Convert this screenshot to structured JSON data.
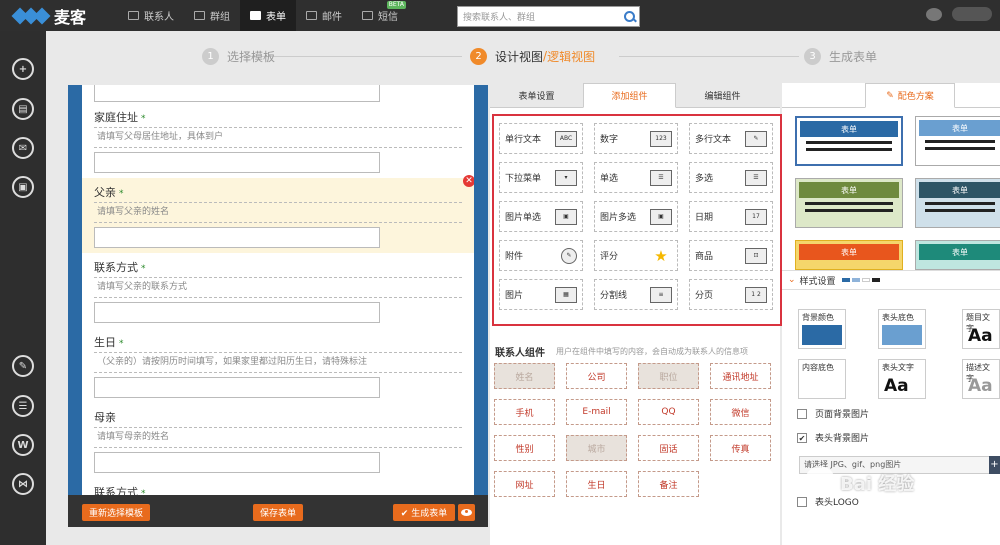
{
  "app": {
    "name": "麦客"
  },
  "nav": [
    {
      "label": "联系人"
    },
    {
      "label": "群组"
    },
    {
      "label": "表单"
    },
    {
      "label": "邮件"
    },
    {
      "label": "短信",
      "badge": "BETA"
    }
  ],
  "search": {
    "placeholder": "搜索联系人、群组"
  },
  "steps": [
    {
      "num": "1",
      "label": "选择模板"
    },
    {
      "num": "2",
      "label_a": "设计视图",
      "sep": "/",
      "label_b": "逻辑视图"
    },
    {
      "num": "3",
      "label": "生成表单"
    }
  ],
  "form": {
    "fields": [
      {
        "title": "家庭住址",
        "hint": "请填写父母居住地址，具体到户"
      },
      {
        "title": "父亲",
        "hint": "请填写父亲的姓名"
      },
      {
        "title": "联系方式",
        "hint": "请填写父亲的联系方式"
      },
      {
        "title": "生日",
        "hint": "（父亲的）请按阴历时间填写，如果家里都过阳历生日，请特殊标注"
      },
      {
        "title": "母亲",
        "hint": "请填写母亲的姓名"
      },
      {
        "title": "联系方式"
      }
    ],
    "required_mark": "*",
    "delete_symbol": "✕",
    "buttons": {
      "reselect": "重新选择模板",
      "save": "保存表单",
      "generate": "✔ 生成表单"
    }
  },
  "mid_tabs": [
    "表单设置",
    "添加组件",
    "编辑组件"
  ],
  "components": [
    {
      "label": "单行文本",
      "icon": "ABC"
    },
    {
      "label": "数字",
      "icon": "123"
    },
    {
      "label": "多行文本",
      "icon": "✎"
    },
    {
      "label": "下拉菜单",
      "icon": "▾"
    },
    {
      "label": "单选",
      "icon": "☰"
    },
    {
      "label": "多选",
      "icon": "☰"
    },
    {
      "label": "图片单选",
      "icon": "▣"
    },
    {
      "label": "图片多选",
      "icon": "▣"
    },
    {
      "label": "日期",
      "icon": "17"
    },
    {
      "label": "附件",
      "icon": "✎"
    },
    {
      "label": "评分",
      "icon": "★"
    },
    {
      "label": "商品",
      "icon": "⊡"
    },
    {
      "label": "图片",
      "icon": "▦"
    },
    {
      "label": "分割线",
      "icon": "≡"
    },
    {
      "label": "分页",
      "icon": "1 2"
    }
  ],
  "contact": {
    "title": "联系人组件",
    "subtitle": "用户在组件中填写的内容，会自动成为联系人的信息项",
    "items": [
      "姓名",
      "公司",
      "职位",
      "通讯地址",
      "手机",
      "E-mail",
      "QQ",
      "微信",
      "性别",
      "城市",
      "固话",
      "传真",
      "网址",
      "生日",
      "备注"
    ]
  },
  "right": {
    "tab": "配色方案",
    "theme_label": "表单",
    "style_label": "样式设置",
    "cells": [
      {
        "label": "背景颜色"
      },
      {
        "label": "表头底色"
      },
      {
        "label": "题目文字",
        "sample": "Aa"
      },
      {
        "label": "内容底色"
      },
      {
        "label": "表头文字",
        "sample": "Aa"
      },
      {
        "label": "描述文字",
        "sample": "Aa"
      }
    ],
    "check_bg": "页面背景图片",
    "check_header": "表头背景图片",
    "check_logo": "表头LOGO",
    "upload_hint": "请选择 JPG、gif、png图片",
    "plus": "+",
    "check_mark": "✔"
  },
  "watermark": "Bai 经验",
  "colors": {
    "accent": "#e86b1d",
    "formBlue": "#2b6aa5",
    "highlight": "#d9333f"
  }
}
